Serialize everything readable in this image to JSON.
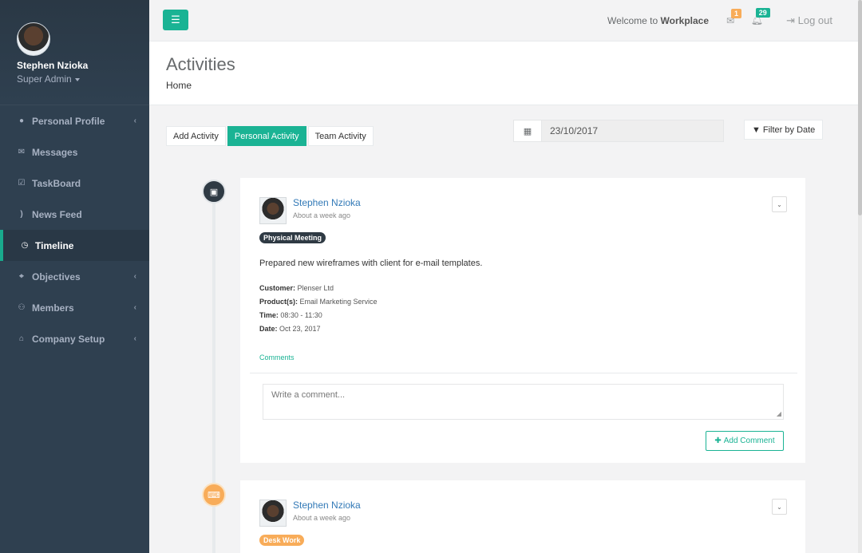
{
  "user": {
    "name": "Stephen Nzioka",
    "role": "Super Admin"
  },
  "sidebar": {
    "items": [
      {
        "label": "Personal Profile",
        "icon": "user-icon",
        "glyph": "●",
        "chevron": true,
        "active": false
      },
      {
        "label": "Messages",
        "icon": "envelope-icon",
        "glyph": "✉",
        "chevron": false,
        "active": false
      },
      {
        "label": "TaskBoard",
        "icon": "check-square-icon",
        "glyph": "☑",
        "chevron": false,
        "active": false
      },
      {
        "label": "News Feed",
        "icon": "rss-icon",
        "glyph": ")",
        "chevron": false,
        "active": false
      },
      {
        "label": "Timeline",
        "icon": "clock-icon",
        "glyph": "◷",
        "chevron": false,
        "active": true
      },
      {
        "label": "Objectives",
        "icon": "crosshairs-icon",
        "glyph": "⌖",
        "chevron": true,
        "active": false
      },
      {
        "label": "Members",
        "icon": "users-icon",
        "glyph": "⚇",
        "chevron": true,
        "active": false
      },
      {
        "label": "Company Setup",
        "icon": "bank-icon",
        "glyph": "⌂",
        "chevron": true,
        "active": false
      }
    ]
  },
  "topbar": {
    "welcome_prefix": "Welcome to",
    "welcome_brand": "Workplace",
    "mail_count": "1",
    "bell_count": "29",
    "logout_label": "Log out"
  },
  "heading": {
    "title": "Activities",
    "breadcrumb": "Home"
  },
  "tabs": [
    "Add Activity",
    "Personal Activity",
    "Team Activity"
  ],
  "active_tab": "Personal Activity",
  "date_filter": {
    "value": "23/10/2017",
    "button_label": "Filter by Date"
  },
  "activities": [
    {
      "author": "Stephen Nzioka",
      "time_ago": "About a week ago",
      "tag": "Physical Meeting",
      "description": "Prepared new wireframes with client for e-mail templates.",
      "customer_label": "Customer:",
      "customer": "Plenser Ltd",
      "products_label": "Product(s):",
      "products": "Email Marketing Service",
      "time_label": "Time:",
      "time": "08:30 - 11:30",
      "date_label": "Date:",
      "date": "Oct 23, 2017",
      "comments_label": "Comments",
      "comment_placeholder": "Write a comment...",
      "add_comment_label": "Add Comment"
    },
    {
      "author": "Stephen Nzioka",
      "time_ago": "About a week ago",
      "tag": "Desk Work"
    }
  ],
  "colors": {
    "primary": "#1ab394",
    "sidebar": "#2f4050",
    "warning": "#f8ac59",
    "dark": "#2f3a44"
  }
}
